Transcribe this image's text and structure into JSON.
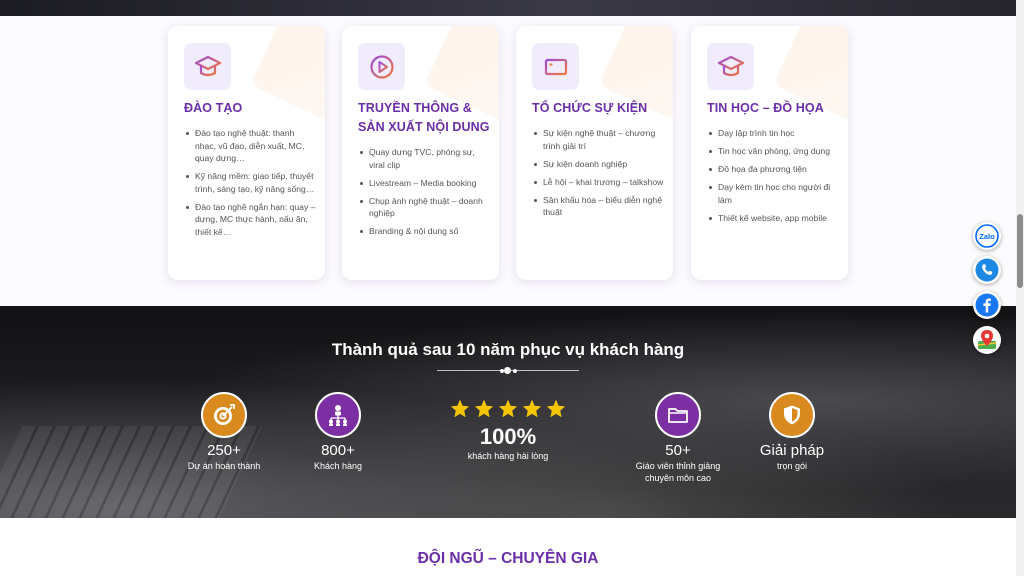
{
  "services": [
    {
      "icon": "graduation-cap-icon",
      "title_lines": [
        "ĐÀO TẠO"
      ],
      "items": [
        "Đào tạo nghệ thuật: thanh nhạc, vũ đạo, diễn xuất, MC, quay dựng…",
        "Kỹ năng mềm: giao tiếp, thuyết trình, sáng tạo, kỹ năng sống…",
        "Đào tạo nghề ngắn hạn: quay – dựng, MC thực hành, nấu ăn, thiết kế…"
      ]
    },
    {
      "icon": "play-circle-icon",
      "title_lines": [
        "TRUYỀN THÔNG &",
        "SẢN XUẤT NỘI DUNG"
      ],
      "items": [
        "Quay dựng TVC, phóng sự, viral clip",
        "Livestream – Media booking",
        "Chụp ảnh nghệ thuật – doanh nghiệp",
        "Branding & nội dung số"
      ]
    },
    {
      "icon": "tv-screen-icon",
      "title_lines": [
        "TỔ CHỨC SỰ KIỆN"
      ],
      "items": [
        "Sự kiện nghệ thuật – chương trình giải trí",
        "Sự kiện doanh nghiệp",
        "Lễ hội – khai trương – talkshow",
        "Sân khấu hóa – biểu diễn nghệ thuật"
      ]
    },
    {
      "icon": "graduation-cap-icon",
      "title_lines": [
        "TIN HỌC – ĐỒ HỌA"
      ],
      "items": [
        "Dạy lập trình tin học",
        "Tin học văn phòng, ứng dụng",
        "Đồ họa đa phương tiện",
        "Dạy kèm tin học cho người đi làm",
        "Thiết kế website, app mobile"
      ]
    }
  ],
  "stats": {
    "title": "Thành quả sau 10 năm phục vụ khách hàng",
    "projects": {
      "value": "250+",
      "label": "Dự án hoàn thành",
      "icon": "target-icon"
    },
    "clients": {
      "value": "800+",
      "label": "Khách hàng",
      "icon": "network-people-icon"
    },
    "rating": {
      "stars": 5,
      "value": "100%",
      "label": "khách hàng hài lòng"
    },
    "teachers": {
      "value": "50+",
      "label_lines": [
        "Giáo viên thỉnh giảng",
        "chuyên môn cao"
      ],
      "icon": "folder-icon"
    },
    "solution": {
      "value": "Giải pháp",
      "label": "trọn gói",
      "icon": "shield-icon"
    }
  },
  "team": {
    "title": "ĐỘI NGŨ – CHUYÊN GIA"
  },
  "float_buttons": {
    "zalo_label": "Zalo",
    "items": [
      "zalo-icon",
      "phone-icon",
      "facebook-icon",
      "map-pin-icon"
    ]
  },
  "colors": {
    "brand_purple": "#6a2ea8",
    "stat_orange": "#d98a1e",
    "stat_purple": "#7b2fa3",
    "star_yellow": "#f5c400",
    "facebook_blue": "#1877f2",
    "zalo_blue": "#0068ff"
  }
}
